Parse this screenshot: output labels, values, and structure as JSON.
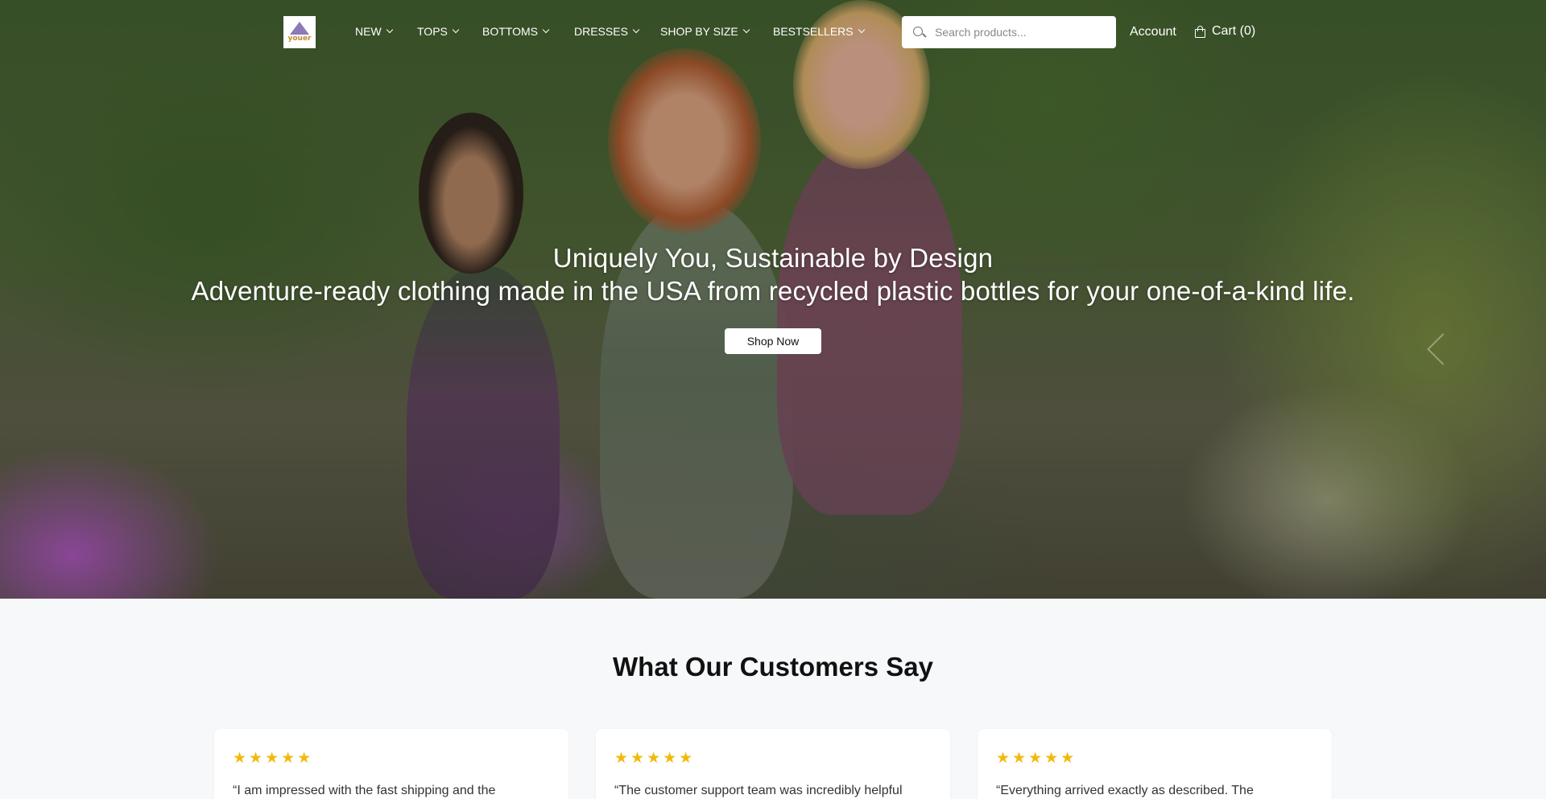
{
  "brand": {
    "logo_text": "youer"
  },
  "nav": {
    "items": [
      {
        "label": "NEW"
      },
      {
        "label": "TOPS"
      },
      {
        "label": "BOTTOMS"
      },
      {
        "label": "DRESSES"
      },
      {
        "label": "SHOP BY SIZE"
      },
      {
        "label": "BESTSELLERS"
      }
    ]
  },
  "search": {
    "placeholder": "Search products...",
    "value": ""
  },
  "account": {
    "label": "Account"
  },
  "cart": {
    "label": "Cart (0)"
  },
  "hero": {
    "title": "Uniquely You, Sustainable by Design",
    "subtitle": "Adventure-ready clothing made in the USA from recycled plastic bottles for your one-of-a-kind life.",
    "cta": "Shop Now"
  },
  "testimonials": {
    "title": "What Our Customers Say",
    "items": [
      {
        "stars": "★★★★★",
        "quote": "“I am impressed with the fast shipping and the"
      },
      {
        "stars": "★★★★★",
        "quote": "“The customer support team was incredibly helpful"
      },
      {
        "stars": "★★★★★",
        "quote": "“Everything arrived exactly as described. The"
      }
    ]
  },
  "colors": {
    "accent_star": "#f2b90c",
    "hero_text": "#ffffff",
    "section_bg": "#f7f8fa"
  }
}
